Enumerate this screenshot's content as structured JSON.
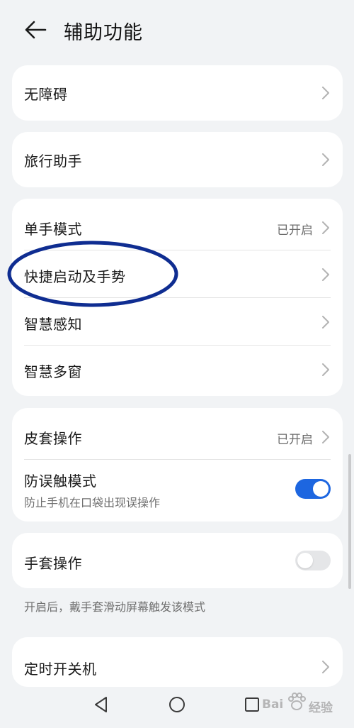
{
  "header": {
    "back_icon": "arrow-left-icon",
    "title": "辅助功能"
  },
  "groups": {
    "accessibility": {
      "label": "无障碍"
    },
    "travel_assistant": {
      "label": "旅行助手"
    },
    "gestures_group": {
      "one_hand_mode": {
        "label": "单手模式",
        "status": "已开启"
      },
      "quick_launch": {
        "label": "快捷启动及手势"
      },
      "smart_sensing": {
        "label": "智慧感知"
      },
      "smart_multiwindow": {
        "label": "智慧多窗"
      }
    },
    "protection_group": {
      "cover_operation": {
        "label": "皮套操作",
        "status": "已开启"
      },
      "accidental_touch": {
        "label": "防误触模式",
        "sub": "防止手机在口袋出现误操作",
        "toggle_on": true
      }
    },
    "glove_group": {
      "glove_mode": {
        "label": "手套操作",
        "toggle_on": false
      },
      "note": "开启后，戴手套滑动屏幕触发该模式"
    },
    "scheduled_power": {
      "label": "定时开关机"
    }
  },
  "navbar": {
    "back_icon": "triangle-back-icon",
    "home_icon": "circle-home-icon",
    "recents_icon": "square-recents-icon"
  },
  "watermark": {
    "brand": "Bai",
    "suffix": "经验",
    "icon": "paw-icon"
  },
  "colors": {
    "background": "#f1f3f5",
    "card": "#ffffff",
    "accent": "#1d66e0",
    "annotation": "#0f2d91"
  }
}
